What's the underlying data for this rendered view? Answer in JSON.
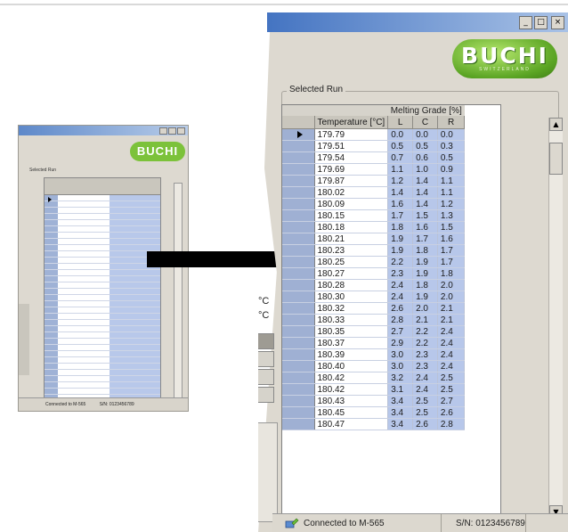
{
  "window": {
    "controls": [
      "_",
      "□",
      "×"
    ],
    "logo": "BUCHI",
    "logo_sub": "SWITZERLAND"
  },
  "group": {
    "label": "Selected Run"
  },
  "table": {
    "super_header": "Melting Grade [%]",
    "headers": [
      "Temperature [°C]",
      "L",
      "C",
      "R"
    ],
    "rows": [
      [
        "179.79",
        "0.0",
        "0.0",
        "0.0"
      ],
      [
        "179.51",
        "0.5",
        "0.5",
        "0.3"
      ],
      [
        "179.54",
        "0.7",
        "0.6",
        "0.5"
      ],
      [
        "179.69",
        "1.1",
        "1.0",
        "0.9"
      ],
      [
        "179.87",
        "1.2",
        "1.4",
        "1.1"
      ],
      [
        "180.02",
        "1.4",
        "1.4",
        "1.1"
      ],
      [
        "180.09",
        "1.6",
        "1.4",
        "1.2"
      ],
      [
        "180.15",
        "1.7",
        "1.5",
        "1.3"
      ],
      [
        "180.18",
        "1.8",
        "1.6",
        "1.5"
      ],
      [
        "180.21",
        "1.9",
        "1.7",
        "1.6"
      ],
      [
        "180.23",
        "1.9",
        "1.8",
        "1.7"
      ],
      [
        "180.25",
        "2.2",
        "1.9",
        "1.7"
      ],
      [
        "180.27",
        "2.3",
        "1.9",
        "1.8"
      ],
      [
        "180.28",
        "2.4",
        "1.8",
        "2.0"
      ],
      [
        "180.30",
        "2.4",
        "1.9",
        "2.0"
      ],
      [
        "180.32",
        "2.6",
        "2.0",
        "2.1"
      ],
      [
        "180.33",
        "2.8",
        "2.1",
        "2.1"
      ],
      [
        "180.35",
        "2.7",
        "2.2",
        "2.4"
      ],
      [
        "180.37",
        "2.9",
        "2.2",
        "2.4"
      ],
      [
        "180.39",
        "3.0",
        "2.3",
        "2.4"
      ],
      [
        "180.40",
        "3.0",
        "2.3",
        "2.4"
      ],
      [
        "180.42",
        "3.2",
        "2.4",
        "2.5"
      ],
      [
        "180.42",
        "3.1",
        "2.4",
        "2.5"
      ],
      [
        "180.43",
        "3.4",
        "2.5",
        "2.7"
      ],
      [
        "180.45",
        "3.4",
        "2.5",
        "2.6"
      ],
      [
        "180.47",
        "3.4",
        "2.6",
        "2.8"
      ]
    ]
  },
  "status": {
    "connection": "Connected to M-565",
    "serial": "S/N: 0123456789"
  },
  "left_units": [
    "°C",
    "°C"
  ],
  "thumbnail": {
    "logo": "BUCHI",
    "group_label": "Selected Run",
    "status": "Connected to M-565",
    "serial": "S/N: 0123456789"
  },
  "colors": {
    "title_bar": "#4474c2",
    "logo_green": "#5aa423",
    "value_cells": "#b7c7ea",
    "row_header": "#9fb0d3"
  }
}
